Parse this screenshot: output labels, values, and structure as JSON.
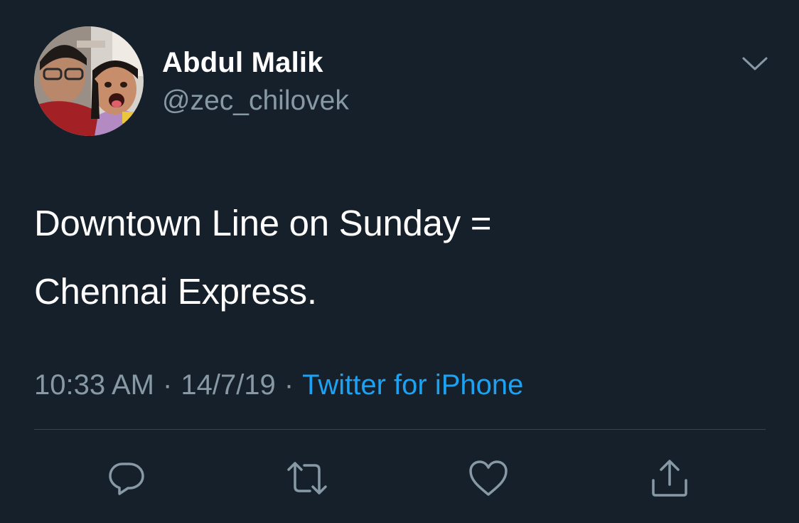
{
  "author": {
    "display_name": "Abdul Malik",
    "handle": "@zec_chilovek"
  },
  "tweet": {
    "text_lines": [
      "Downtown Line on Sunday =",
      "Chennai Express."
    ],
    "time": "10:33 AM",
    "separator": "·",
    "date": "14/7/19",
    "source": "Twitter for iPhone"
  },
  "icons": {
    "menu": "chevron-down-icon",
    "reply": "reply-icon",
    "retweet": "retweet-icon",
    "like": "heart-icon",
    "share": "share-icon"
  },
  "colors": {
    "background": "#15202b",
    "primary_text": "#ffffff",
    "secondary_text": "#8899a6",
    "link": "#1da1f2",
    "divider": "#38444d"
  }
}
